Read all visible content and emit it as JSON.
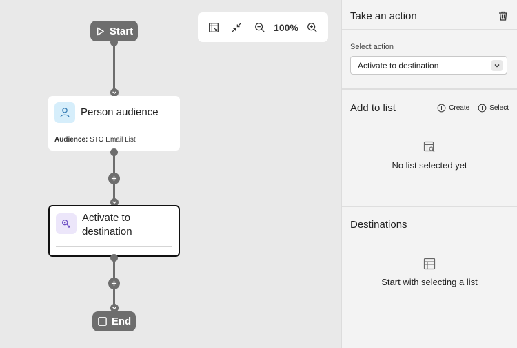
{
  "canvas": {
    "start_label": "Start",
    "end_label": "End",
    "nodes": [
      {
        "title": "Person audience",
        "meta_label": "Audience:",
        "meta_value": "STO Email List"
      },
      {
        "title": "Activate to destination"
      }
    ],
    "toolbar": {
      "zoom_level": "100%"
    }
  },
  "panel": {
    "action_title": "Take an action",
    "select_label": "Select action",
    "select_value": "Activate to destination",
    "list_title": "Add to list",
    "create_label": "Create",
    "select_btn_label": "Select",
    "list_empty": "No list selected yet",
    "dest_title": "Destinations",
    "dest_empty": "Start with selecting a list"
  },
  "colors": {
    "accent_person": "#3a7fb6",
    "accent_activate": "#6d4fc4",
    "connector": "#6e6e6e"
  }
}
